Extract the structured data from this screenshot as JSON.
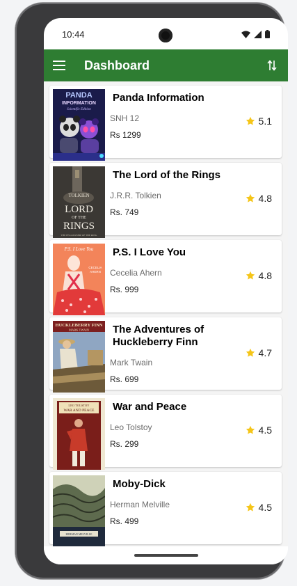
{
  "status_bar": {
    "time": "10:44"
  },
  "app_bar": {
    "title": "Dashboard"
  },
  "books": [
    {
      "title": "Panda Information",
      "author": "SNH 12",
      "price": "Rs 1299",
      "rating": "5.1"
    },
    {
      "title": "The Lord of the Rings",
      "author": "J.R.R. Tolkien",
      "price": "Rs. 749",
      "rating": "4.8"
    },
    {
      "title": "P.S. I Love You",
      "author": "Cecelia Ahern",
      "price": "Rs. 999",
      "rating": "4.8"
    },
    {
      "title": "The Adventures of Huckleberry Finn",
      "author": "Mark Twain",
      "price": "Rs. 699",
      "rating": "4.7"
    },
    {
      "title": "War and Peace",
      "author": "Leo Tolstoy",
      "price": "Rs. 299",
      "rating": "4.5"
    },
    {
      "title": "Moby-Dick",
      "author": "Herman Melville",
      "price": "Rs. 499",
      "rating": "4.5"
    }
  ],
  "cover_art_text": {
    "panda": [
      "PANDA",
      "INFORMATION",
      "Scientific Edition"
    ],
    "lotr": [
      "TOLKIEN",
      "LORD",
      "OF THE",
      "RINGS",
      "THE FELLOWSHIP OF THE RING"
    ],
    "ps": [
      "P.S. I Love You",
      "CECELIA",
      "AHERN"
    ],
    "huck": [
      "HUCKLEBERRY FINN",
      "MARK TWAIN"
    ],
    "war": [
      "LEO TOLSTOY",
      "WAR AND PEACE"
    ],
    "moby": [
      "HERMAN MELVILLE"
    ]
  },
  "colors": {
    "app_bar": "#2e7d32",
    "star": "#f5c518",
    "frame": "#3a3a3c"
  },
  "icons": {
    "menu": "hamburger-menu-icon",
    "sort": "sort-arrows-icon",
    "rating": "star-icon"
  }
}
